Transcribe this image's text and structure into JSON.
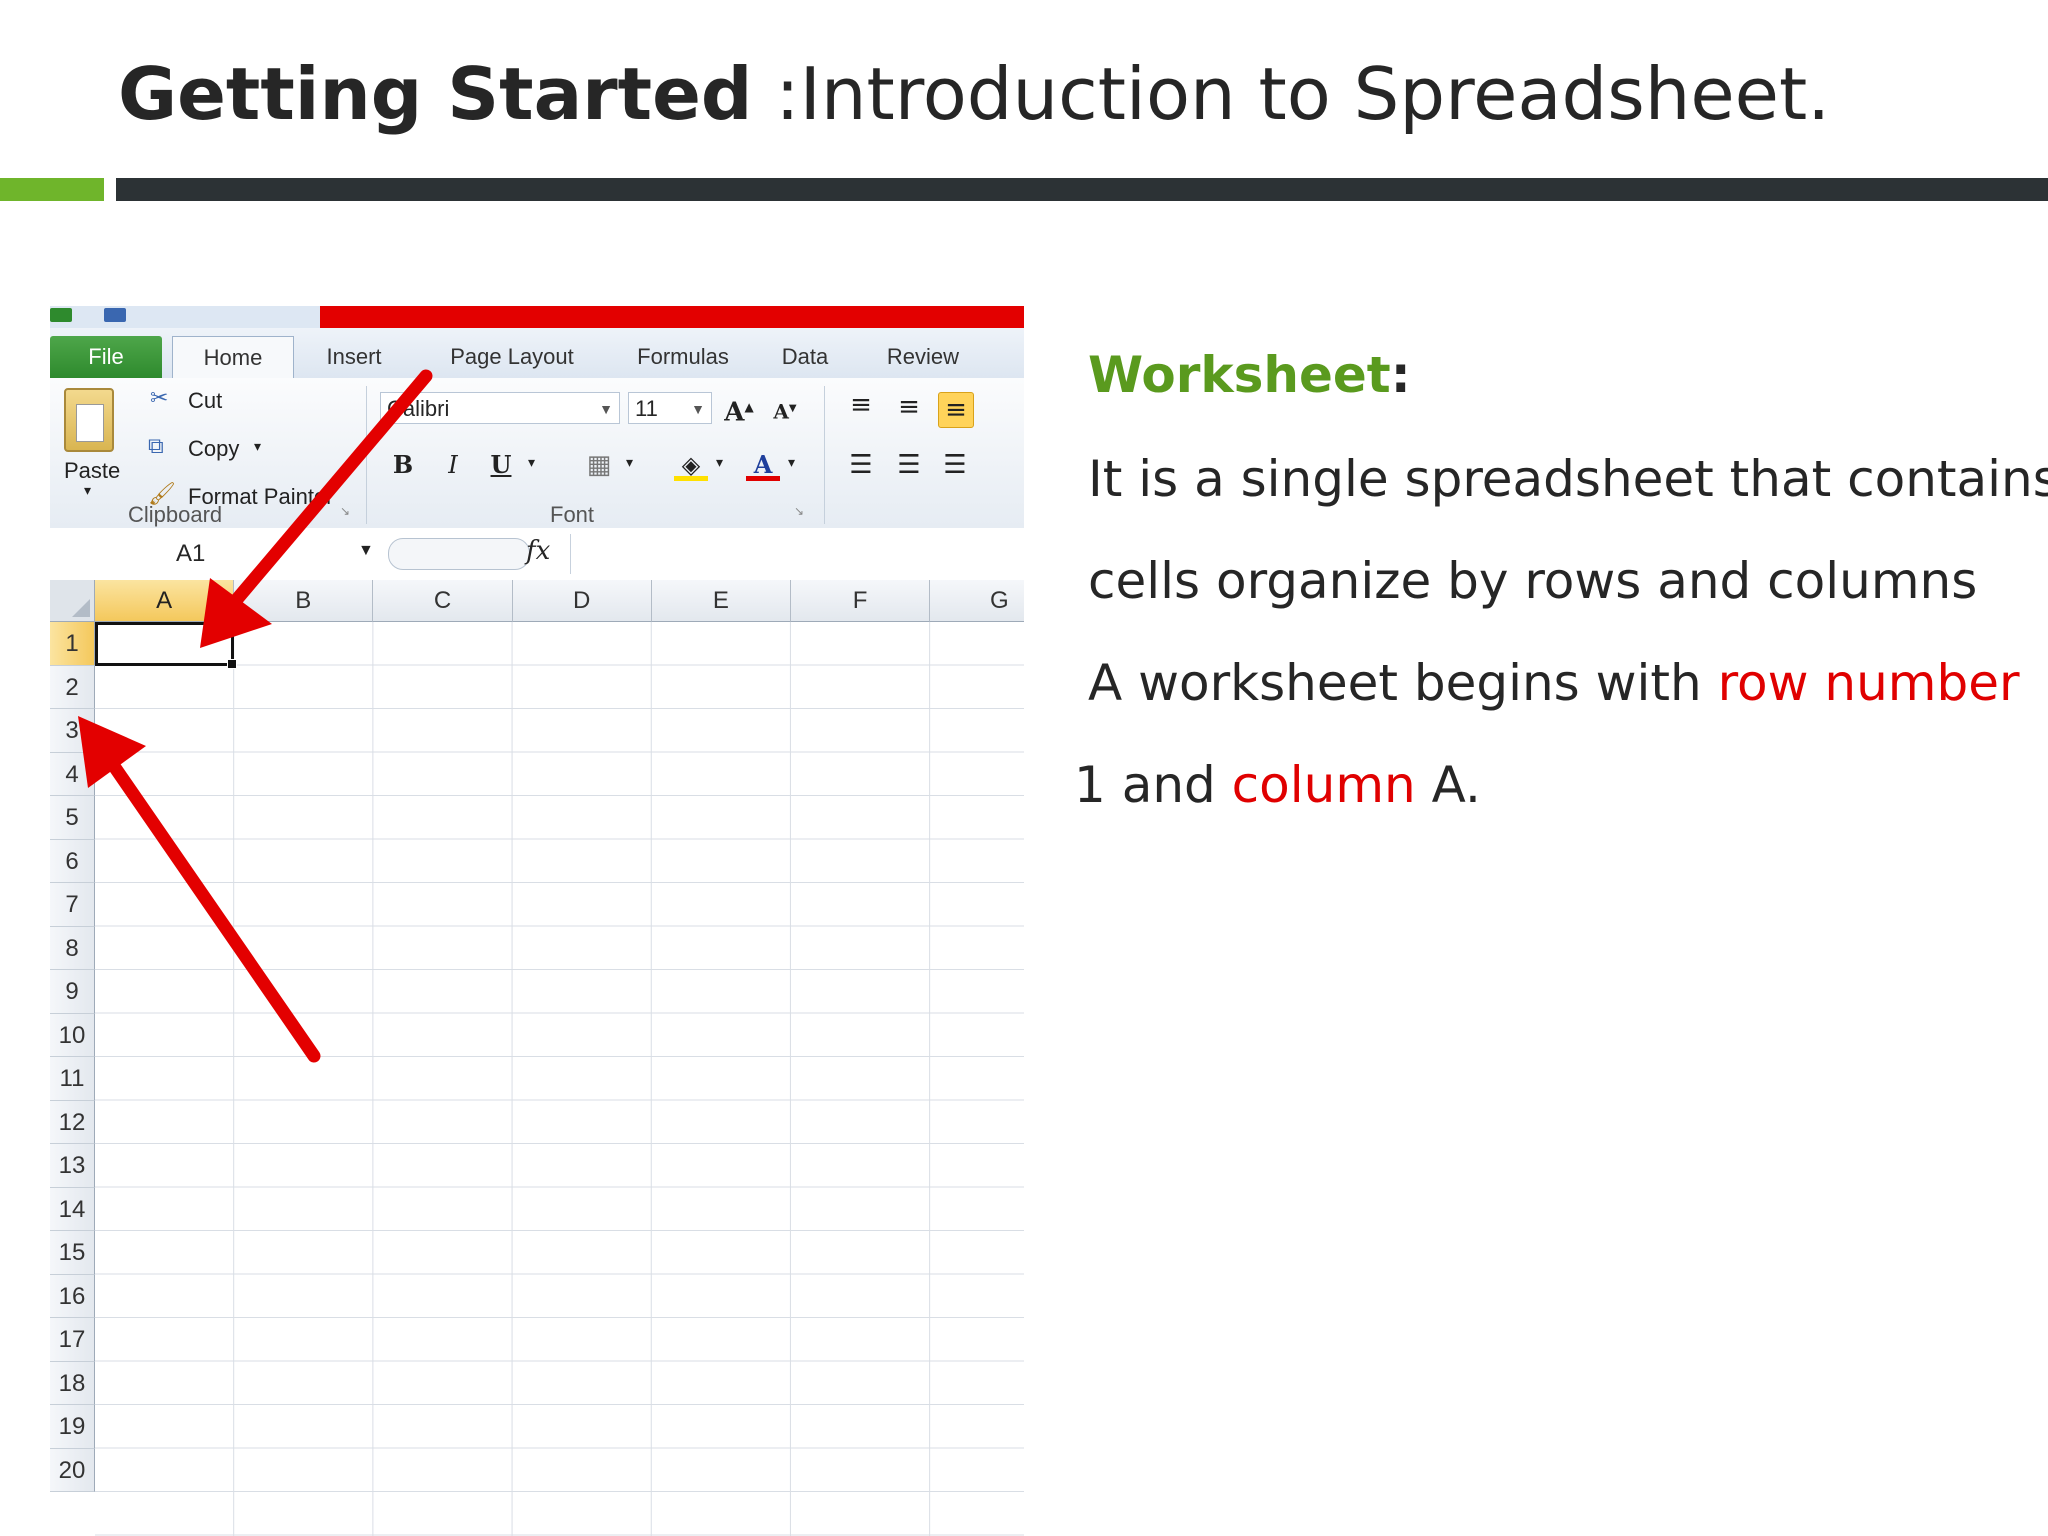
{
  "slide": {
    "title_bold": "Getting Started",
    "title_rest": " :Introduction to Spreadsheet.",
    "accent_colors": {
      "green": "#6fb52b",
      "dark": "#2c3235",
      "highlight": "#e00000",
      "heading": "#5a9a1e"
    }
  },
  "excel": {
    "tabs": [
      "File",
      "Home",
      "Insert",
      "Page Layout",
      "Formulas",
      "Data",
      "Review"
    ],
    "clipboard": {
      "paste": "Paste",
      "cut": "Cut",
      "copy": "Copy",
      "format_painter": "Format Painter",
      "group_label": "Clipboard"
    },
    "font": {
      "font_name": "Calibri",
      "font_size": "11",
      "bold": "B",
      "italic": "I",
      "underline": "U",
      "group_label": "Font"
    },
    "formula_bar": {
      "name_box": "A1",
      "fx": "fx"
    },
    "columns": [
      "A",
      "B",
      "C",
      "D",
      "E",
      "F",
      "G"
    ],
    "rows": [
      "1",
      "2",
      "3",
      "4",
      "5",
      "6",
      "7",
      "8",
      "9",
      "10",
      "11",
      "12",
      "13",
      "14",
      "15",
      "16",
      "17",
      "18",
      "19",
      "20"
    ],
    "active_cell": "A1"
  },
  "text": {
    "heading": "Worksheet",
    "heading_colon": ":",
    "line1": "It is a  single spreadsheet that contains",
    "line2": "cells organize by rows and columns",
    "line3_a": "A worksheet begins with ",
    "line3_b": "row number",
    "line4_a": "1 and ",
    "line4_b": "column",
    "line4_c": "  A."
  }
}
